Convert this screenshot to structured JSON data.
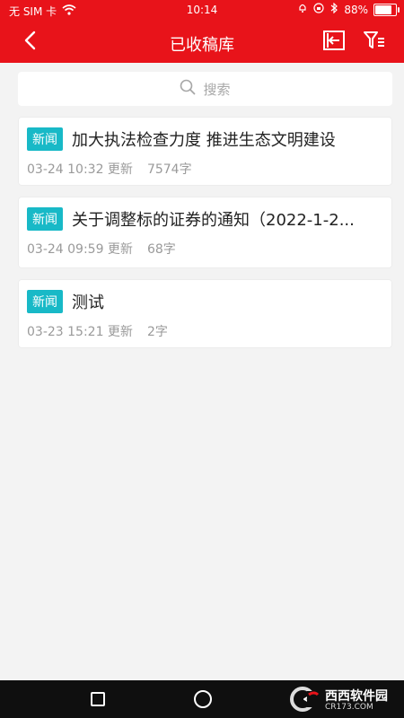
{
  "status": {
    "carrier": "无 SIM 卡",
    "time": "10:14",
    "battery": "88%",
    "battery_level": 0.88
  },
  "header": {
    "title": "已收稿库"
  },
  "search": {
    "placeholder": "搜索"
  },
  "items": [
    {
      "badge": "新闻",
      "title": "加大执法检查力度 推进生态文明建设",
      "time": "03-24 10:32 更新",
      "count": "7574字"
    },
    {
      "badge": "新闻",
      "title": "关于调整标的证券的通知（2022-1-2...",
      "time": "03-24 09:59 更新",
      "count": "68字"
    },
    {
      "badge": "新闻",
      "title": "测试",
      "time": "03-23 15:21 更新",
      "count": "2字"
    }
  ],
  "watermark": {
    "brand": "西西软件园",
    "url": "CR173.COM"
  },
  "icons": {
    "back": "chevron-left-icon",
    "import": "import-icon",
    "filter": "filter-icon",
    "search": "search-icon"
  },
  "colors": {
    "header": "#e8131a",
    "badge": "#18b9c7",
    "background": "#f3f3f3"
  }
}
